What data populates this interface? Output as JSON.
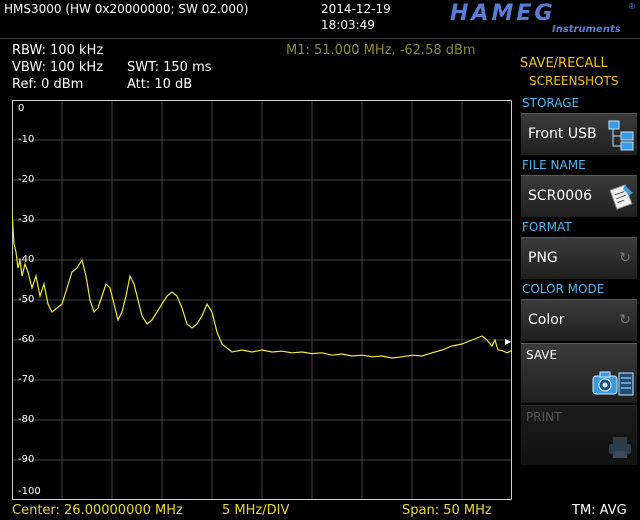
{
  "header": {
    "model": "HMS3000 (HW 0x20000000; SW 02.000)",
    "date": "2014-12-19",
    "time": "18:03:49",
    "brand": "HAMEG",
    "brand_sub": "Instruments",
    "brand_reg": "®"
  },
  "settings": {
    "rbw": "RBW: 100 kHz",
    "vbw": "VBW: 100 kHz",
    "swt": "SWT: 150 ms",
    "ref": "Ref: 0 dBm",
    "att": "Att: 10 dB"
  },
  "marker_readout": "M1: 51.000 MHz, -62.58 dBm",
  "chart_data": {
    "type": "line",
    "y_tick_labels": [
      "0",
      "-10",
      "-20",
      "-30",
      "-40",
      "-50",
      "-60",
      "-70",
      "-80",
      "-90",
      "-100"
    ],
    "ylim": [
      -100,
      0
    ],
    "xlim": [
      1,
      51
    ],
    "grid": true,
    "series": [
      {
        "color": "#f0e63c",
        "x": [
          1.0,
          1.2,
          1.4,
          1.6,
          1.8,
          2.0,
          2.3,
          2.6,
          3.0,
          3.4,
          3.8,
          4.2,
          4.6,
          5.0,
          5.5,
          6.0,
          6.5,
          7.0,
          7.5,
          8.0,
          8.4,
          8.8,
          9.2,
          9.6,
          10.0,
          10.4,
          10.8,
          11.2,
          11.6,
          12.0,
          12.4,
          12.8,
          13.2,
          13.6,
          14.0,
          14.5,
          15.0,
          15.5,
          16.0,
          16.5,
          17.0,
          17.5,
          18.0,
          18.5,
          19.0,
          19.5,
          20.0,
          20.5,
          21.0,
          21.5,
          22.0,
          22.5,
          23.0,
          24.0,
          25.0,
          26.0,
          27.0,
          28.0,
          29.0,
          30.0,
          31.0,
          32.0,
          33.0,
          34.0,
          35.0,
          36.0,
          37.0,
          38.0,
          39.0,
          40.0,
          41.0,
          42.0,
          43.0,
          44.0,
          45.0,
          46.0,
          47.0,
          47.5,
          48.0,
          48.5,
          49.0,
          49.3,
          49.6,
          50.0,
          50.5,
          51.0
        ],
        "y": [
          -28,
          -36,
          -38,
          -42,
          -40,
          -44,
          -41,
          -43,
          -47,
          -44,
          -49,
          -46,
          -51,
          -53,
          -52,
          -51,
          -47,
          -43,
          -42,
          -40,
          -44,
          -50,
          -53,
          -52,
          -49,
          -46,
          -47,
          -51,
          -55,
          -53,
          -49,
          -44,
          -46,
          -50,
          -54,
          -56,
          -55,
          -53,
          -51,
          -49,
          -48,
          -49,
          -52,
          -56,
          -57,
          -56,
          -54,
          -51,
          -53,
          -58,
          -61,
          -62,
          -63,
          -62.5,
          -63,
          -62.5,
          -63,
          -62.8,
          -63.2,
          -63,
          -63.4,
          -63.2,
          -63.8,
          -63.5,
          -64,
          -63.8,
          -64.2,
          -64,
          -64.5,
          -64.2,
          -63.8,
          -64,
          -63.2,
          -62.5,
          -61.5,
          -61,
          -60,
          -59.5,
          -59,
          -60,
          -61.5,
          -60,
          -62.5,
          -62.6,
          -63.2,
          -62.6
        ]
      }
    ]
  },
  "footer": {
    "center": "Center: 26.00000000 MHz",
    "div": "5 MHz/DIV",
    "span": "Span: 50 MHz",
    "trace_mode": "TM: AVG"
  },
  "menu": {
    "title_line1": "SAVE/RECALL",
    "title_line2": "SCREENSHOTS",
    "storage_label": "STORAGE",
    "storage_value": "Front USB",
    "file_name_label": "FILE NAME",
    "file_name_value": "SCR0006",
    "format_label": "FORMAT",
    "format_value": "PNG",
    "color_mode_label": "COLOR MODE",
    "color_mode_value": "Color",
    "save_label": "SAVE",
    "print_label": "PRINT"
  }
}
